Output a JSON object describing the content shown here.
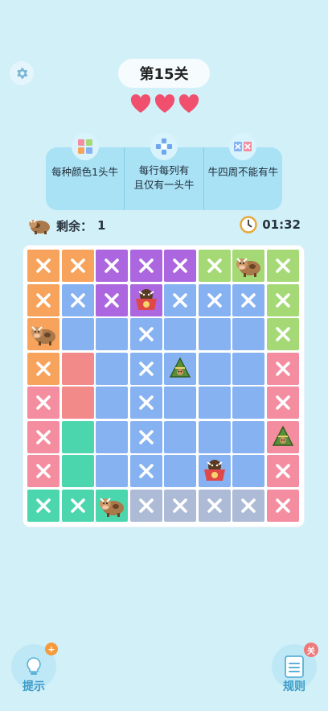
{
  "header": {
    "level_title": "第15关",
    "lives": 3
  },
  "rules": [
    {
      "icon": "color-grid-icon",
      "text": "每种颜色1头牛"
    },
    {
      "icon": "cross-shape-icon",
      "text": "每行每列有\n且仅有一头牛"
    },
    {
      "icon": "adjacent-x-icon",
      "text": "牛四周不能有牛"
    }
  ],
  "status": {
    "remaining_label": "剩余：",
    "remaining_count": "1",
    "timer": "01:32"
  },
  "colors": {
    "orange": "#f7a35b",
    "purple": "#ac67e0",
    "green": "#a5d975",
    "blue": "#86b2f2",
    "pink": "#f48da0",
    "teal": "#4cd6ae",
    "gray": "#aebbd6",
    "red": "#f38a8a"
  },
  "board": {
    "rows": [
      [
        "orange",
        "orange",
        "purple",
        "purple",
        "purple",
        "green",
        "green",
        "green"
      ],
      [
        "orange",
        "blue",
        "purple",
        "purple",
        "blue",
        "blue",
        "blue",
        "green"
      ],
      [
        "orange",
        "blue",
        "blue",
        "blue",
        "blue",
        "blue",
        "blue",
        "green"
      ],
      [
        "orange",
        "red",
        "blue",
        "blue",
        "blue",
        "blue",
        "blue",
        "pink"
      ],
      [
        "pink",
        "red",
        "blue",
        "blue",
        "blue",
        "blue",
        "blue",
        "pink"
      ],
      [
        "pink",
        "teal",
        "blue",
        "blue",
        "blue",
        "blue",
        "blue",
        "pink"
      ],
      [
        "pink",
        "teal",
        "blue",
        "blue",
        "blue",
        "blue",
        "blue",
        "pink"
      ],
      [
        "teal",
        "teal",
        "teal",
        "gray",
        "gray",
        "gray",
        "gray",
        "pink"
      ]
    ],
    "marks": [
      [
        "x",
        "x",
        "x",
        "x",
        "x",
        "x",
        "cow",
        "x"
      ],
      [
        "x",
        "x",
        "x",
        "cow-bowl",
        "x",
        "x",
        "x",
        "x"
      ],
      [
        "cow",
        "",
        "",
        "x",
        "",
        "",
        "",
        "x"
      ],
      [
        "x",
        "",
        "",
        "x",
        "cow-zongzi",
        "",
        "",
        "x"
      ],
      [
        "x",
        "",
        "",
        "x",
        "",
        "",
        "",
        "x"
      ],
      [
        "x",
        "",
        "",
        "x",
        "",
        "",
        "",
        "cow-zongzi"
      ],
      [
        "x",
        "",
        "",
        "x",
        "",
        "cow-bowl",
        "",
        "x"
      ],
      [
        "x",
        "x",
        "cow",
        "x",
        "x",
        "x",
        "x",
        "x"
      ]
    ]
  },
  "footer": {
    "hint_label": "提示",
    "rules_label": "规则"
  }
}
